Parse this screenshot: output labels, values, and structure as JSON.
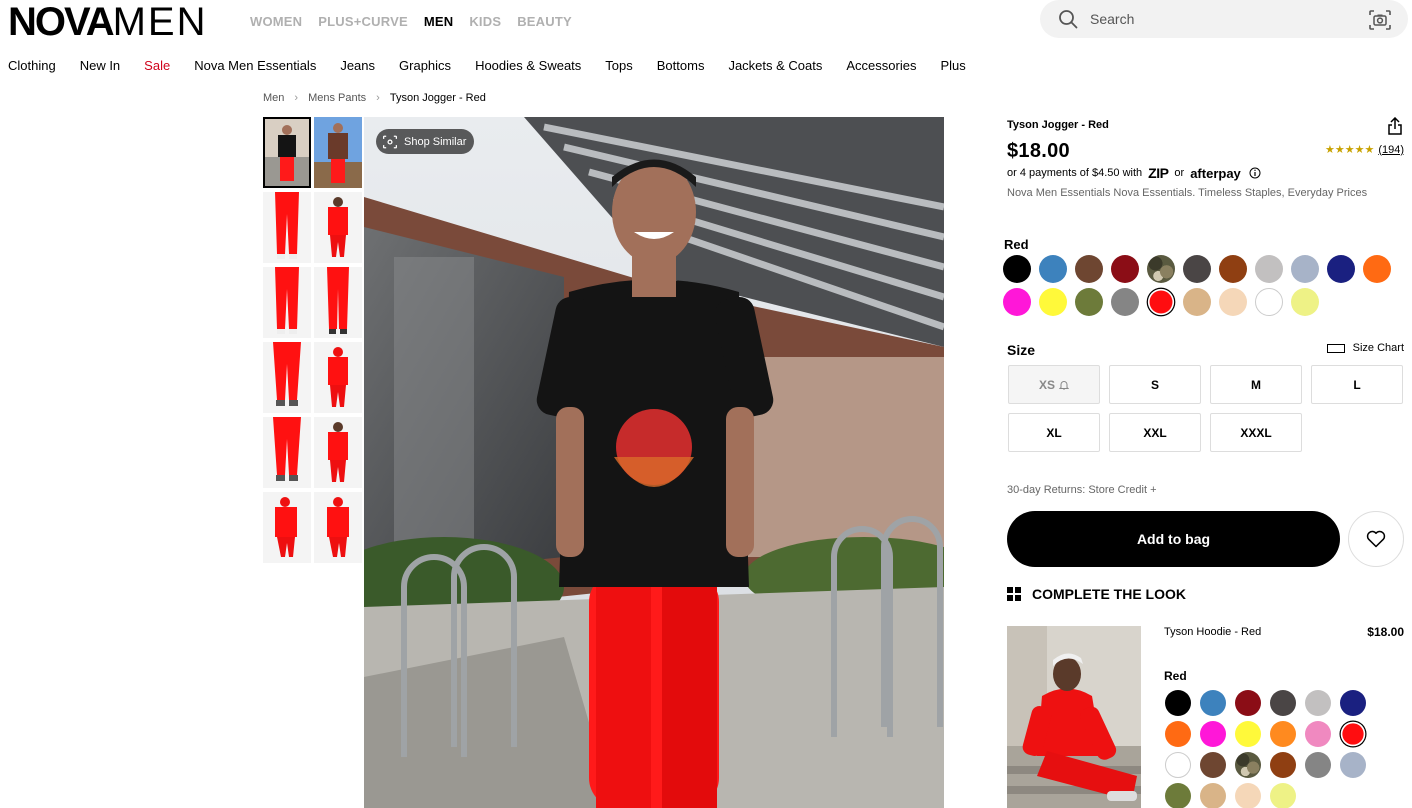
{
  "header": {
    "logo_bold": "NOVA",
    "logo_light": "MEN",
    "main_nav": [
      {
        "label": "WOMEN",
        "active": false
      },
      {
        "label": "PLUS+CURVE",
        "active": false
      },
      {
        "label": "MEN",
        "active": true
      },
      {
        "label": "KIDS",
        "active": false
      },
      {
        "label": "BEAUTY",
        "active": false
      }
    ],
    "search": {
      "placeholder": "Search",
      "icon": "search-icon",
      "camera_icon": "camera-search-icon"
    }
  },
  "subnav": [
    {
      "label": "Clothing"
    },
    {
      "label": "New In"
    },
    {
      "label": "Sale",
      "highlight": true
    },
    {
      "label": "Nova Men Essentials"
    },
    {
      "label": "Jeans"
    },
    {
      "label": "Graphics"
    },
    {
      "label": "Hoodies & Sweats"
    },
    {
      "label": "Tops"
    },
    {
      "label": "Bottoms"
    },
    {
      "label": "Jackets & Coats"
    },
    {
      "label": "Accessories"
    },
    {
      "label": "Plus"
    }
  ],
  "breadcrumb": [
    "Men",
    "Mens Pants",
    "Tyson Jogger - Red"
  ],
  "gallery": {
    "shop_similar_label": "Shop Similar",
    "thumbnail_count": 12,
    "selected_thumbnail": 1
  },
  "product": {
    "title": "Tyson Jogger - Red",
    "price": "$18.00",
    "rating_stars": "★★★★★",
    "rating_count": "(194)",
    "installments": {
      "prefix": "or 4 payments of $4.50 with",
      "zip_label": "ZIP",
      "or": "or",
      "afterpay_label": "afterpay"
    },
    "tagline": "Nova Men Essentials Nova Essentials. Timeless Staples, Everyday Prices",
    "selected_color": "Red",
    "colors": [
      "#000000",
      "#3d82bd",
      "#6e4631",
      "#8b0d16",
      "camo",
      "#4a4545",
      "#8f3f12",
      "#c2c0c0",
      "#a7b3c8",
      "#1a2080",
      "#ff6a13",
      "#ff17d8",
      "#fff93a",
      "#6d7b3a",
      "#858585",
      "#ff0d10",
      "#d9b488",
      "#f5d7b8",
      "#ffffff",
      "#eef286"
    ],
    "selected_color_index": 15,
    "size_label": "Size",
    "size_chart_label": "Size Chart",
    "sizes": [
      {
        "label": "XS",
        "out_of_stock": true
      },
      {
        "label": "S"
      },
      {
        "label": "M"
      },
      {
        "label": "L"
      },
      {
        "label": "XL"
      },
      {
        "label": "XXL"
      },
      {
        "label": "XXXL"
      }
    ],
    "returns": "30-day Returns: Store Credit +",
    "add_to_bag": "Add to bag"
  },
  "complete_the_look": {
    "heading": "COMPLETE THE LOOK",
    "item": {
      "name": "Tyson Hoodie - Red",
      "price": "$18.00",
      "selected_color": "Red",
      "colors": [
        "#000000",
        "#3d82bd",
        "#8b0d16",
        "#4a4545",
        "#c2c0c0",
        "#1a2080",
        "#ff6a13",
        "#ff17d8",
        "#fff93a",
        "#ff8a1f",
        "#f089c0",
        "#ff0d10",
        "#ffffff",
        "#6e4631",
        "camo",
        "#8f3f12",
        "#858585",
        "#a7b3c8",
        "#6d7b3a",
        "#d9b488",
        "#f5d7b8",
        "#eef286"
      ],
      "selected_color_index": 11
    }
  }
}
